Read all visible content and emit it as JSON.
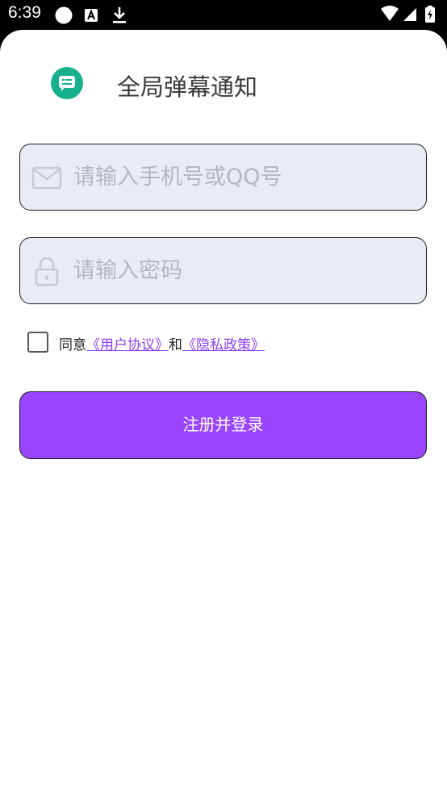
{
  "status_bar": {
    "time": "6:39",
    "left_icons": [
      "circle-notification-icon",
      "font-a-icon",
      "download-icon"
    ],
    "right_icons": [
      "wifi-icon",
      "signal-icon",
      "battery-charging-icon"
    ]
  },
  "header": {
    "app_icon": "message-bubble-icon",
    "title": "全局弹幕通知"
  },
  "login_form": {
    "account_field": {
      "icon": "mail-icon",
      "value": "",
      "placeholder": "请输入手机号或QQ号"
    },
    "password_field": {
      "icon": "lock-icon",
      "value": "",
      "placeholder": "请输入密码"
    },
    "agreement": {
      "checked": false,
      "prefix": "同意",
      "user_agreement_link": "《用户协议》",
      "conjunction": "和",
      "privacy_policy_link": "《隐私政策》"
    },
    "submit_label": "注册并登录"
  },
  "colors": {
    "accent": "#9945fb",
    "logo": "#16b08f",
    "field_background": "#e9ecf4",
    "link": "#8e3df2"
  }
}
